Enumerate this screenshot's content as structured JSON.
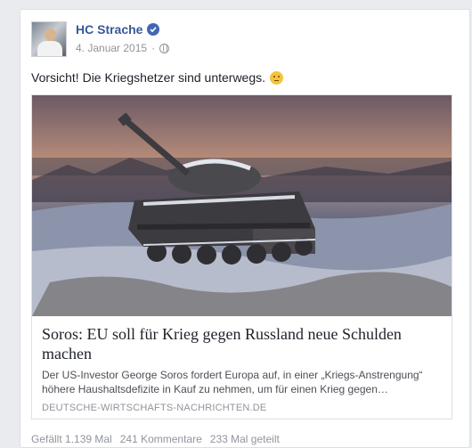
{
  "post": {
    "author": "HC Strache",
    "date": "4. Januar 2015",
    "separator": "·",
    "text": "Vorsicht! Die Kriegshetzer sind unterwegs.",
    "emoji_icon": "confused-face-emoji"
  },
  "link": {
    "title": "Soros: EU soll für Krieg gegen Russland neue Schulden machen",
    "description": "Der US-Investor George Soros fordert Europa auf, in einer „Kriegs-Anstrengung“ höhere Haushaltsdefizite in Kauf zu nehmen, um für einen Krieg gegen…",
    "domain": "DEUTSCHE-WIRTSCHAFTS-NACHRICHTEN.DE"
  },
  "stats": {
    "likes": "Gefällt 1.139 Mal",
    "comments": "241 Kommentare",
    "shares": "233 Mal geteilt"
  },
  "colors": {
    "link_blue": "#365899",
    "verified_blue": "#4267b2",
    "meta_gray": "#90949c",
    "page_bg": "#e9ebee"
  }
}
